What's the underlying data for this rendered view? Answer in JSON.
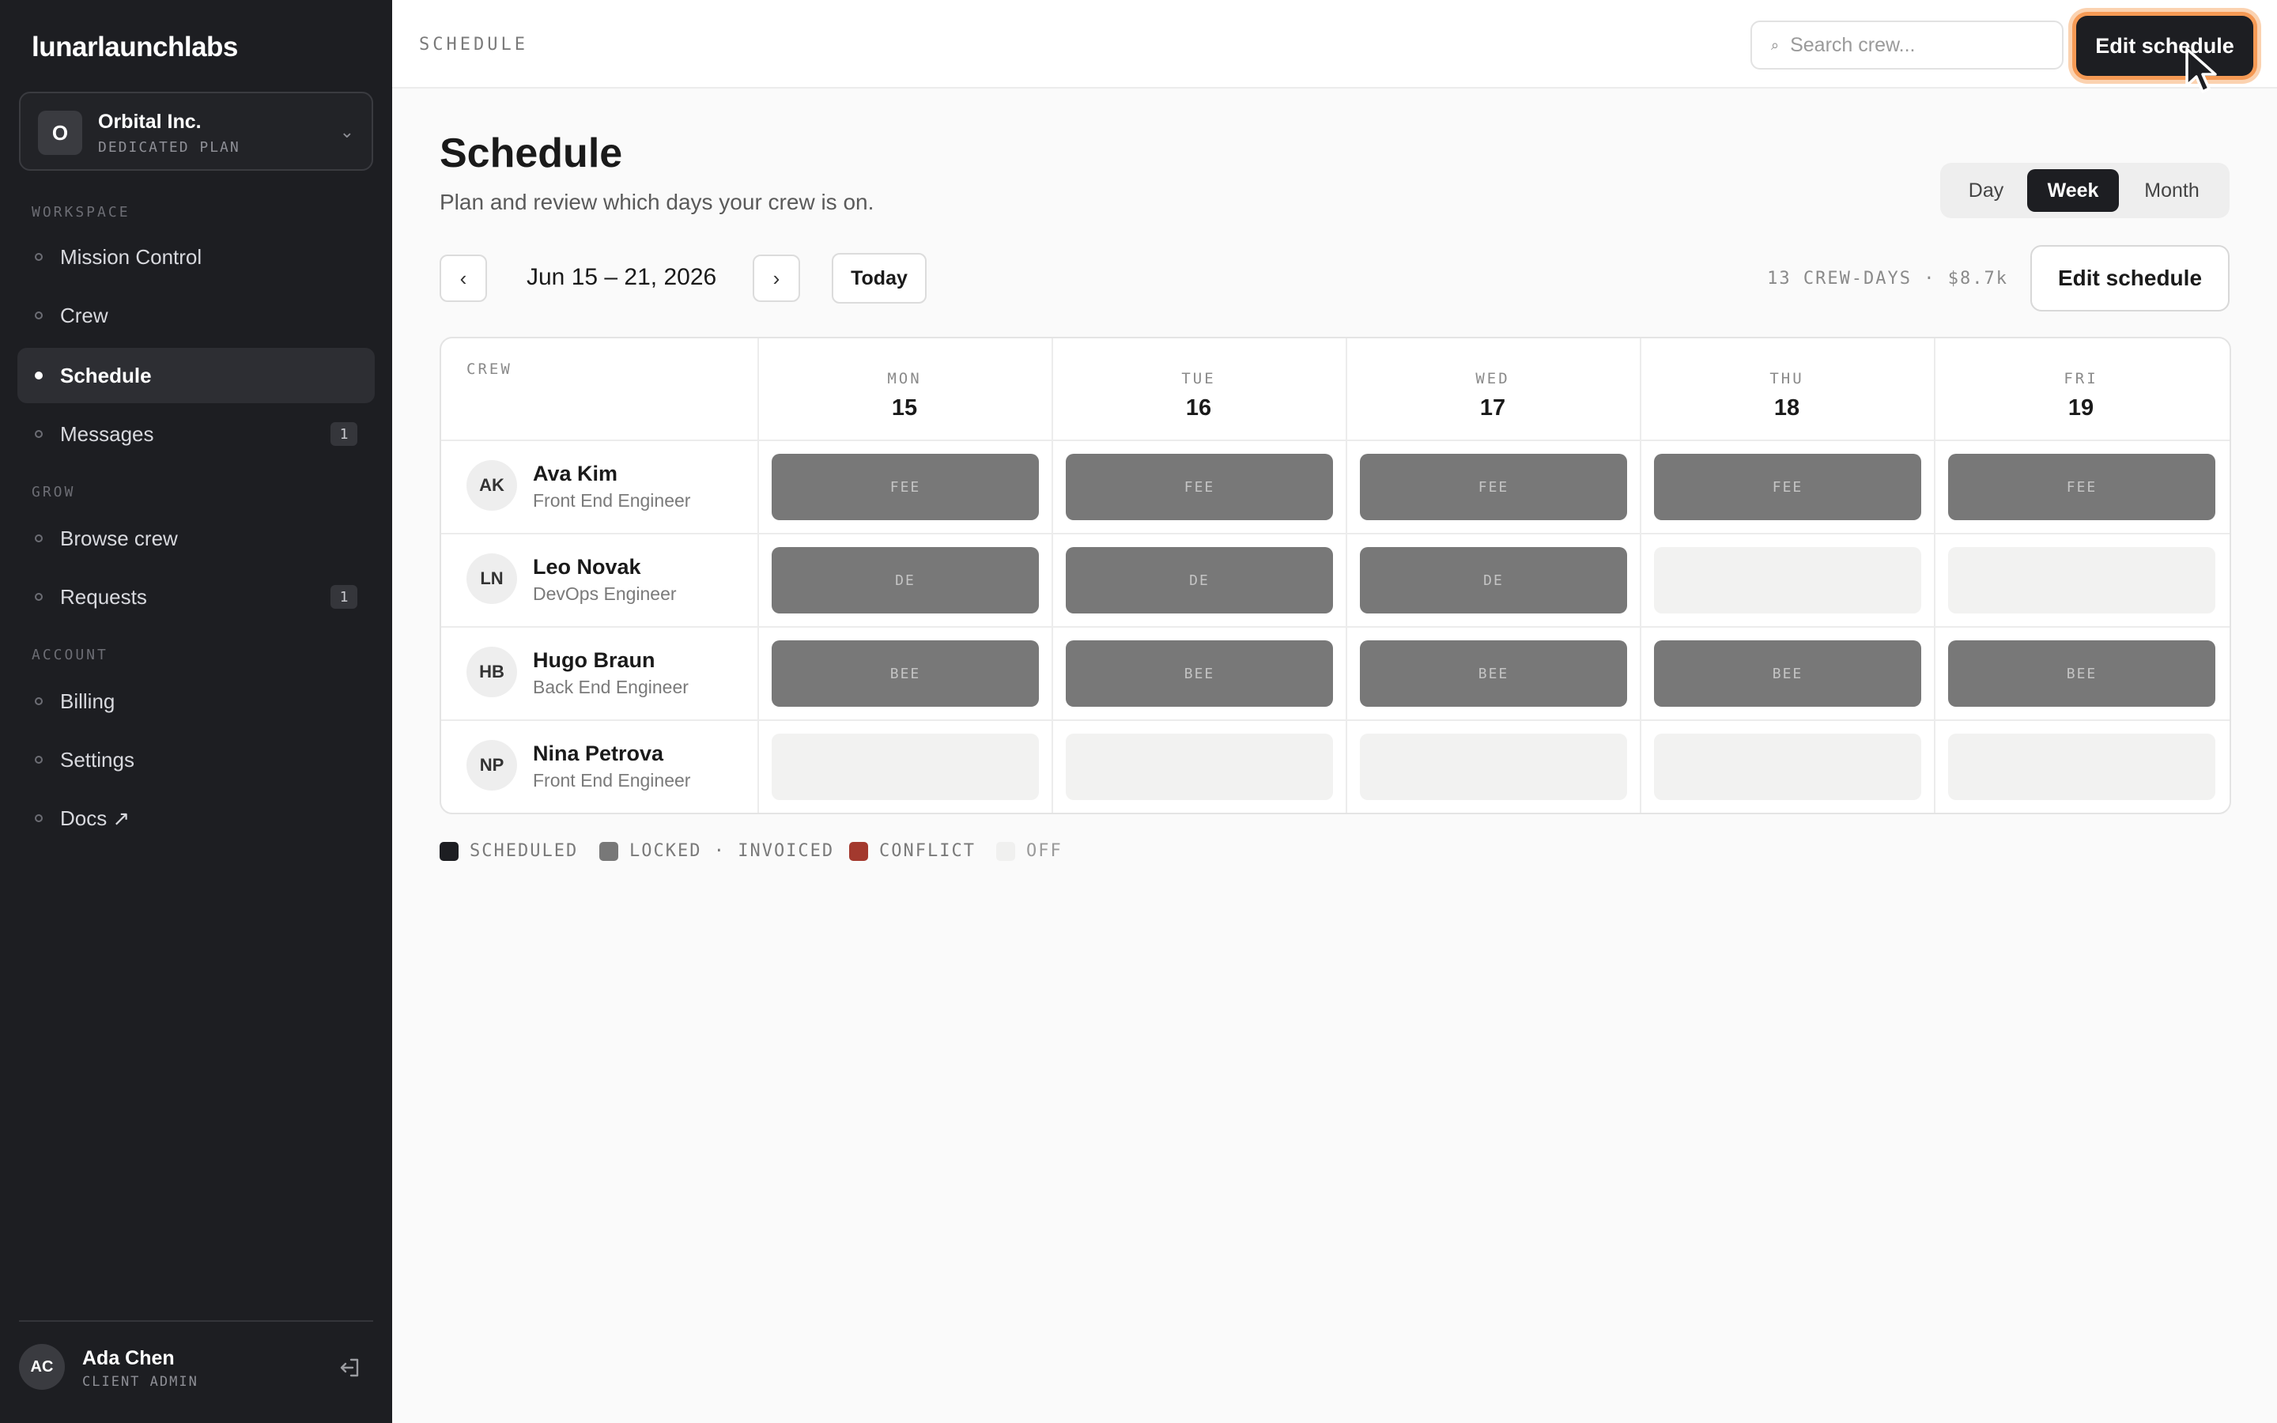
{
  "app": {
    "brand": "lunarlaunchlabs"
  },
  "org": {
    "avatar": "O",
    "name": "Orbital Inc.",
    "plan": "DEDICATED PLAN"
  },
  "sidebar": {
    "sections": [
      "WORKSPACE",
      "GROW",
      "ACCOUNT"
    ],
    "items": [
      {
        "label": "Mission Control"
      },
      {
        "label": "Crew"
      },
      {
        "label": "Schedule",
        "active": true
      },
      {
        "label": "Messages",
        "badge": "1"
      },
      {
        "label": "Browse crew"
      },
      {
        "label": "Requests",
        "badge": "1"
      },
      {
        "label": "Billing"
      },
      {
        "label": "Settings"
      },
      {
        "label": "Docs ↗"
      }
    ]
  },
  "user": {
    "initials": "AC",
    "name": "Ada Chen",
    "role": "CLIENT ADMIN"
  },
  "topbar": {
    "breadcrumb": "SCHEDULE",
    "search_placeholder": "Search crew...",
    "edit_label": "Edit schedule"
  },
  "page": {
    "title": "Schedule",
    "subtitle": "Plan and review which days your crew is on."
  },
  "view_toggle": {
    "options": [
      "Day",
      "Week",
      "Month"
    ],
    "selected": "Week"
  },
  "date_nav": {
    "prev": "‹",
    "next": "›",
    "range": "Jun 15 – 21, 2026",
    "today_label": "Today"
  },
  "summary": "13 CREW-DAYS · $8.7k",
  "edit_button": "Edit schedule",
  "grid": {
    "crew_header": "CREW",
    "days": [
      {
        "name": "MON",
        "num": "15"
      },
      {
        "name": "TUE",
        "num": "16"
      },
      {
        "name": "WED",
        "num": "17"
      },
      {
        "name": "THU",
        "num": "18"
      },
      {
        "name": "FRI",
        "num": "19"
      }
    ],
    "rows": [
      {
        "initials": "AK",
        "name": "Ava Kim",
        "role": "Front End Engineer",
        "cells": [
          {
            "state": "locked",
            "label": "FEE"
          },
          {
            "state": "locked",
            "label": "FEE"
          },
          {
            "state": "locked",
            "label": "FEE"
          },
          {
            "state": "locked",
            "label": "FEE"
          },
          {
            "state": "locked",
            "label": "FEE"
          }
        ]
      },
      {
        "initials": "LN",
        "name": "Leo Novak",
        "role": "DevOps Engineer",
        "cells": [
          {
            "state": "locked",
            "label": "DE"
          },
          {
            "state": "locked",
            "label": "DE"
          },
          {
            "state": "locked",
            "label": "DE"
          },
          {
            "state": "off",
            "label": ""
          },
          {
            "state": "off",
            "label": ""
          }
        ]
      },
      {
        "initials": "HB",
        "name": "Hugo Braun",
        "role": "Back End Engineer",
        "cells": [
          {
            "state": "locked",
            "label": "BEE"
          },
          {
            "state": "locked",
            "label": "BEE"
          },
          {
            "state": "locked",
            "label": "BEE"
          },
          {
            "state": "locked",
            "label": "BEE"
          },
          {
            "state": "locked",
            "label": "BEE"
          }
        ]
      },
      {
        "initials": "NP",
        "name": "Nina Petrova",
        "role": "Front End Engineer",
        "cells": [
          {
            "state": "off",
            "label": ""
          },
          {
            "state": "off",
            "label": ""
          },
          {
            "state": "off",
            "label": ""
          },
          {
            "state": "off",
            "label": ""
          },
          {
            "state": "off",
            "label": ""
          }
        ]
      }
    ]
  },
  "legend": [
    {
      "label": "SCHEDULED",
      "color": "#1d1e22"
    },
    {
      "label": "LOCKED · INVOICED",
      "color": "#787878"
    },
    {
      "label": "CONFLICT",
      "color": "#a3392e"
    },
    {
      "label": "OFF",
      "color": "#f0f0ef"
    }
  ],
  "colors": {
    "sidebar_bg": "#1d1e22",
    "accent_ring": "#f59a55",
    "locked": "#787878",
    "off": "#f2f2f1"
  }
}
